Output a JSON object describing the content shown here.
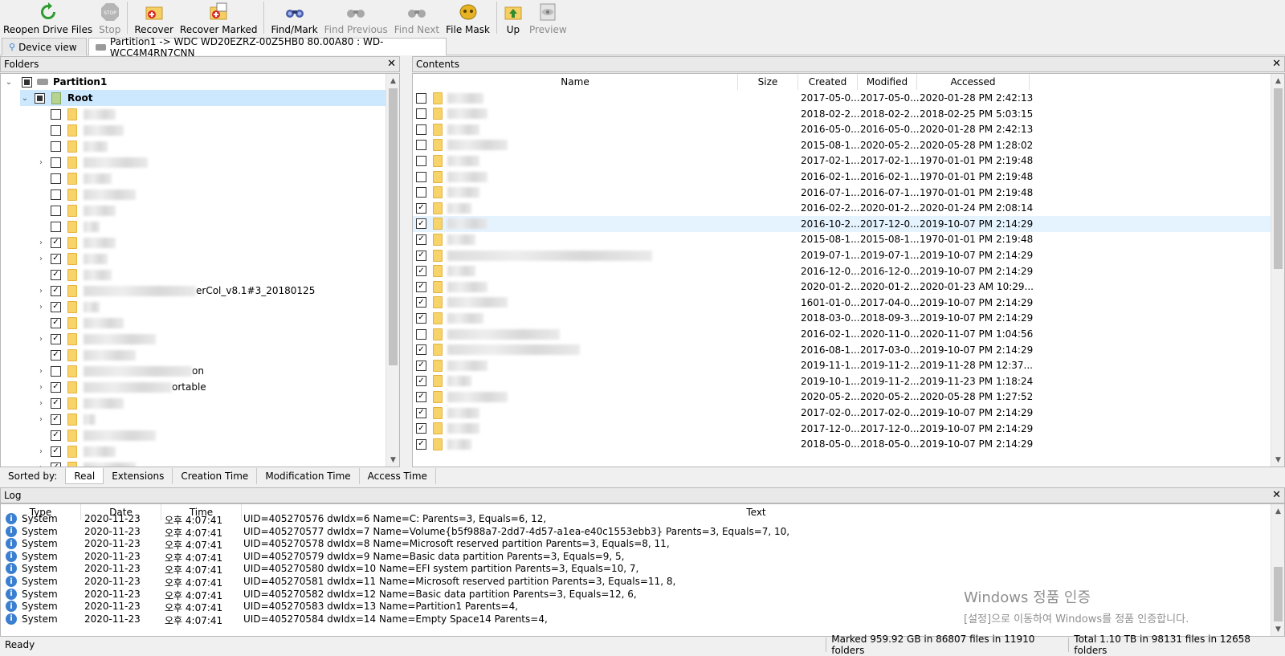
{
  "toolbar": {
    "buttons": [
      {
        "label": "Reopen Drive Files",
        "icon": "refresh-icon"
      },
      {
        "label": "Stop",
        "icon": "stop-icon"
      },
      {
        "label": "Recover",
        "icon": "recover-icon"
      },
      {
        "label": "Recover Marked",
        "icon": "recover-marked-icon"
      },
      {
        "label": "Find/Mark",
        "icon": "binoculars-icon"
      },
      {
        "label": "Find Previous",
        "icon": "find-previous-icon"
      },
      {
        "label": "Find Next",
        "icon": "find-next-icon"
      },
      {
        "label": "File Mask",
        "icon": "file-mask-icon"
      },
      {
        "label": "Up",
        "icon": "up-folder-icon"
      },
      {
        "label": "Preview",
        "icon": "preview-icon"
      }
    ]
  },
  "tabs": {
    "device_view": "Device view",
    "partition": "Partition1 -> WDC WD20EZRZ-00Z5HB0 80.00A80 : WD-WCC4M4RN7CNN"
  },
  "folders": {
    "title": "Folders",
    "root_partition": "Partition1",
    "root": "Root",
    "visible_suffixes": [
      "erCol_v8.1#3_20180125",
      "on",
      "ortable"
    ]
  },
  "contents": {
    "title": "Contents",
    "columns": [
      "Name",
      "Size",
      "Created",
      "Modified",
      "Accessed"
    ],
    "rows": [
      {
        "checked": false,
        "created": "2017-05-0...",
        "modified": "2017-05-0...",
        "accessed": "2020-01-28 PM 2:42:13"
      },
      {
        "checked": false,
        "created": "2018-02-2...",
        "modified": "2018-02-2...",
        "accessed": "2018-02-25 PM 5:03:15"
      },
      {
        "checked": false,
        "created": "2016-05-0...",
        "modified": "2016-05-0...",
        "accessed": "2020-01-28 PM 2:42:13"
      },
      {
        "checked": false,
        "created": "2015-08-1...",
        "modified": "2020-05-2...",
        "accessed": "2020-05-28 PM 1:28:02"
      },
      {
        "checked": false,
        "created": "2017-02-1...",
        "modified": "2017-02-1...",
        "accessed": "1970-01-01 PM 2:19:48"
      },
      {
        "checked": false,
        "created": "2016-02-1...",
        "modified": "2016-02-1...",
        "accessed": "1970-01-01 PM 2:19:48"
      },
      {
        "checked": false,
        "created": "2016-07-1...",
        "modified": "2016-07-1...",
        "accessed": "1970-01-01 PM 2:19:48"
      },
      {
        "checked": true,
        "created": "2016-02-2...",
        "modified": "2020-01-2...",
        "accessed": "2020-01-24 PM 2:08:14"
      },
      {
        "checked": true,
        "created": "2016-10-2...",
        "modified": "2017-12-0...",
        "accessed": "2019-10-07 PM 2:14:29"
      },
      {
        "checked": true,
        "created": "2015-08-1...",
        "modified": "2015-08-1...",
        "accessed": "1970-01-01 PM 2:19:48"
      },
      {
        "checked": true,
        "created": "2019-07-1...",
        "modified": "2019-07-1...",
        "accessed": "2019-10-07 PM 2:14:29"
      },
      {
        "checked": true,
        "created": "2016-12-0...",
        "modified": "2016-12-0...",
        "accessed": "2019-10-07 PM 2:14:29"
      },
      {
        "checked": true,
        "created": "2020-01-2...",
        "modified": "2020-01-2...",
        "accessed": "2020-01-23 AM 10:29..."
      },
      {
        "checked": true,
        "created": "1601-01-0...",
        "modified": "2017-04-0...",
        "accessed": "2019-10-07 PM 2:14:29"
      },
      {
        "checked": true,
        "created": "2018-03-0...",
        "modified": "2018-09-3...",
        "accessed": "2019-10-07 PM 2:14:29"
      },
      {
        "checked": false,
        "created": "2016-02-1...",
        "modified": "2020-11-0...",
        "accessed": "2020-11-07 PM 1:04:56"
      },
      {
        "checked": true,
        "created": "2016-08-1...",
        "modified": "2017-03-0...",
        "accessed": "2019-10-07 PM 2:14:29"
      },
      {
        "checked": true,
        "created": "2019-11-1...",
        "modified": "2019-11-2...",
        "accessed": "2019-11-28 PM 12:37..."
      },
      {
        "checked": true,
        "created": "2019-10-1...",
        "modified": "2019-11-2...",
        "accessed": "2019-11-23 PM 1:18:24"
      },
      {
        "checked": true,
        "created": "2020-05-2...",
        "modified": "2020-05-2...",
        "accessed": "2020-05-28 PM 1:27:52"
      },
      {
        "checked": true,
        "created": "2017-02-0...",
        "modified": "2017-02-0...",
        "accessed": "2019-10-07 PM 2:14:29"
      },
      {
        "checked": true,
        "created": "2017-12-0...",
        "modified": "2017-12-0...",
        "accessed": "2019-10-07 PM 2:14:29"
      },
      {
        "checked": true,
        "created": "2018-05-0...",
        "modified": "2018-05-0...",
        "accessed": "2019-10-07 PM 2:14:29"
      }
    ]
  },
  "sortbar": {
    "label": "Sorted by:",
    "tabs": [
      "Real",
      "Extensions",
      "Creation Time",
      "Modification Time",
      "Access Time"
    ]
  },
  "log": {
    "title": "Log",
    "columns": [
      "Type",
      "Date",
      "Time",
      "Text"
    ],
    "rows": [
      {
        "type": "System",
        "date": "2020-11-23",
        "time": "오후 4:07:41",
        "text": "UID=405270576 dwIdx=6 Name=C:  Parents=3,   Equals=6, 12,"
      },
      {
        "type": "System",
        "date": "2020-11-23",
        "time": "오후 4:07:41",
        "text": "UID=405270577 dwIdx=7 Name=Volume{b5f988a7-2dd7-4d57-a1ea-e40c1553ebb3}  Parents=3,   Equals=7, 10,"
      },
      {
        "type": "System",
        "date": "2020-11-23",
        "time": "오후 4:07:41",
        "text": "UID=405270578 dwIdx=8 Name=Microsoft reserved partition  Parents=3,   Equals=8, 11,"
      },
      {
        "type": "System",
        "date": "2020-11-23",
        "time": "오후 4:07:41",
        "text": "UID=405270579 dwIdx=9 Name=Basic data partition  Parents=3,   Equals=9, 5,"
      },
      {
        "type": "System",
        "date": "2020-11-23",
        "time": "오후 4:07:41",
        "text": "UID=405270580 dwIdx=10 Name=EFI system partition  Parents=3,   Equals=10, 7,"
      },
      {
        "type": "System",
        "date": "2020-11-23",
        "time": "오후 4:07:41",
        "text": "UID=405270581 dwIdx=11 Name=Microsoft reserved partition  Parents=3,   Equals=11, 8,"
      },
      {
        "type": "System",
        "date": "2020-11-23",
        "time": "오후 4:07:41",
        "text": "UID=405270582 dwIdx=12 Name=Basic data partition  Parents=3,   Equals=12, 6,"
      },
      {
        "type": "System",
        "date": "2020-11-23",
        "time": "오후 4:07:41",
        "text": "UID=405270583 dwIdx=13 Name=Partition1  Parents=4,"
      },
      {
        "type": "System",
        "date": "2020-11-23",
        "time": "오후 4:07:41",
        "text": "UID=405270584 dwIdx=14 Name=Empty Space14  Parents=4,"
      }
    ]
  },
  "status": {
    "ready": "Ready",
    "marked": "Marked 959.92 GB in 86807 files in 11910 folders",
    "total": "Total 1.10 TB in 98131 files in 12658 folders"
  },
  "watermark": {
    "line1": "Windows 정품 인증",
    "line2": "[설정]으로 이동하여 Windows를 정품 인증합니다."
  },
  "colors": {
    "selection": "#cce8ff",
    "folder": "#f8d36a",
    "accent": "#3b7fd0"
  }
}
